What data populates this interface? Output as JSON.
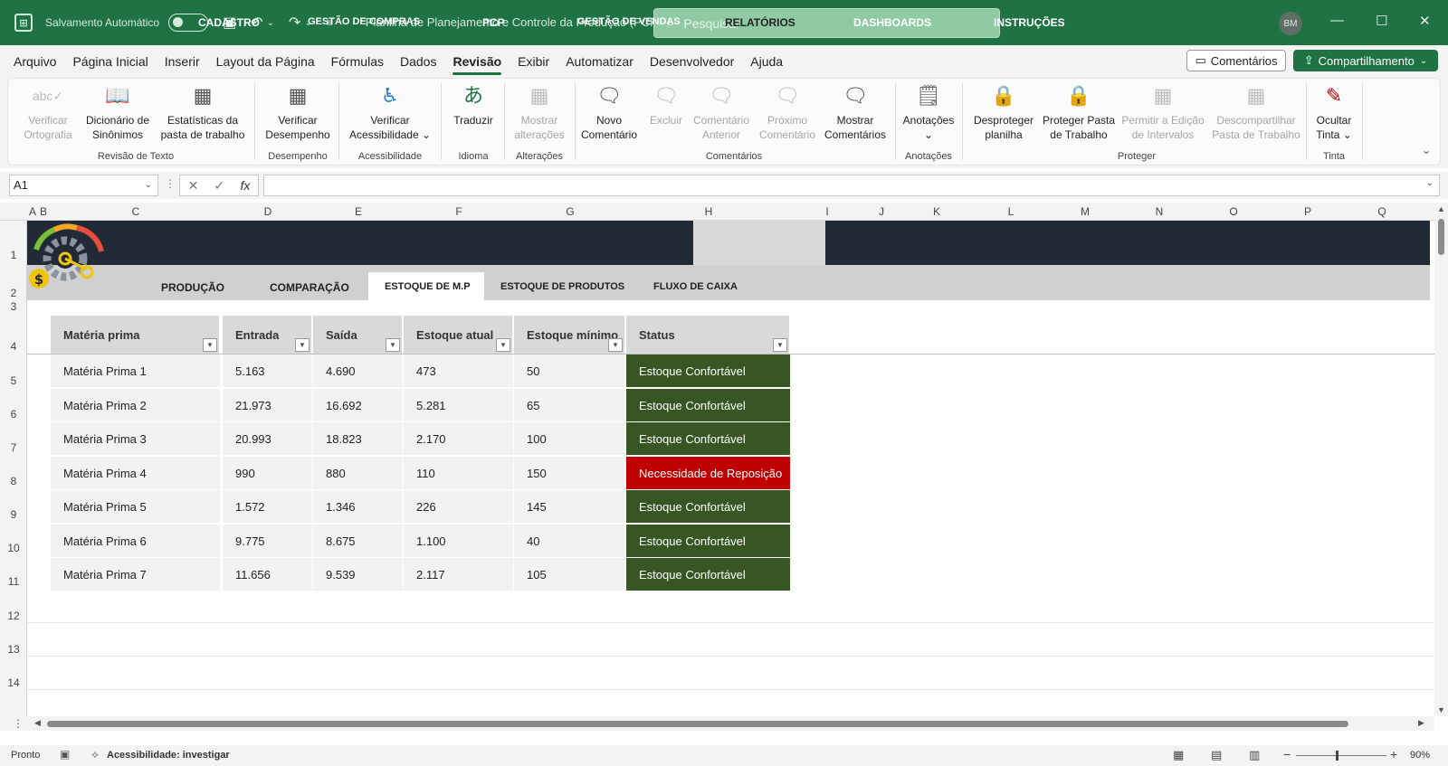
{
  "titlebar": {
    "autosave_label": "Salvamento Automático",
    "doc_title": "Planilha de Planejamento e Controle da Produção (PCP)",
    "search_placeholder": "Pesquisar",
    "avatar_initials": "BM"
  },
  "menu": {
    "items": [
      "Arquivo",
      "Página Inicial",
      "Inserir",
      "Layout da Página",
      "Fórmulas",
      "Dados",
      "Revisão",
      "Exibir",
      "Automatizar",
      "Desenvolvedor",
      "Ajuda"
    ],
    "active": "Revisão",
    "comments_label": "Comentários",
    "share_label": "Compartilhamento"
  },
  "ribbon": {
    "buttons": {
      "spell": "Verificar Ortografia",
      "thesaurus": "Dicionário de Sinônimos",
      "stats": "Estatísticas da pasta de trabalho",
      "perf": "Verificar Desempenho",
      "access": "Verificar Acessibilidade",
      "translate": "Traduzir",
      "changes": "Mostrar alterações",
      "new_comment": "Novo Comentário",
      "delete": "Excluir",
      "prev_comment": "Comentário Anterior",
      "next_comment": "Próximo Comentário",
      "show_comments": "Mostrar Comentários",
      "notes": "Anotações",
      "unprotect": "Desproteger planilha",
      "protect_wb": "Proteger Pasta de Trabalho",
      "allow_edit": "Permitir a Edição de Intervalos",
      "unshare": "Descompartilhar Pasta de Trabalho",
      "hide_ink": "Ocultar Tinta"
    },
    "groups": {
      "review_text": "Revisão de Texto",
      "performance": "Desempenho",
      "accessibility": "Acessibilidade",
      "language": "Idioma",
      "changes": "Alterações",
      "comments": "Comentários",
      "notes": "Anotações",
      "protect": "Proteger",
      "ink": "Tinta"
    }
  },
  "formula_bar": {
    "name_box": "A1",
    "fx": "fx"
  },
  "columns": [
    "A",
    "B",
    "C",
    "D",
    "E",
    "F",
    "G",
    "H",
    "I",
    "J",
    "K",
    "L",
    "M",
    "N",
    "O",
    "P",
    "Q"
  ],
  "rows": [
    "1",
    "2",
    "3",
    "4",
    "5",
    "6",
    "7",
    "8",
    "9",
    "10",
    "11",
    "12",
    "13",
    "14"
  ],
  "nav": {
    "items": [
      "CADASTRO",
      "GESTÃO DE COMPRAS",
      "PCP",
      "GESTÃO DE VENDAS",
      "RELATÓRIOS",
      "DASHBOARDS",
      "INSTRUÇÕES"
    ],
    "active": "RELATÓRIOS",
    "sub_items": [
      "PRODUÇÃO",
      "COMPARAÇÃO",
      "ESTOQUE DE M.P",
      "ESTOQUE DE PRODUTOS",
      "FLUXO DE CAIXA"
    ],
    "sub_active": "ESTOQUE DE M.P"
  },
  "table": {
    "headers": [
      "Matéria prima",
      "Entrada",
      "Saída",
      "Estoque atual",
      "Estoque mínimo",
      "Status"
    ],
    "rows": [
      [
        "Matéria Prima 1",
        "5.163",
        "4.690",
        "473",
        "50",
        "Estoque Confortável"
      ],
      [
        "Matéria Prima 2",
        "21.973",
        "16.692",
        "5.281",
        "65",
        "Estoque Confortável"
      ],
      [
        "Matéria Prima 3",
        "20.993",
        "18.823",
        "2.170",
        "100",
        "Estoque Confortável"
      ],
      [
        "Matéria Prima 4",
        "990",
        "880",
        "110",
        "150",
        "Necessidade de Reposição"
      ],
      [
        "Matéria Prima 5",
        "1.572",
        "1.346",
        "226",
        "145",
        "Estoque Confortável"
      ],
      [
        "Matéria Prima 6",
        "9.775",
        "8.675",
        "1.100",
        "40",
        "Estoque Confortável"
      ],
      [
        "Matéria Prima 7",
        "11.656",
        "9.539",
        "2.117",
        "105",
        "Estoque Confortável"
      ]
    ],
    "status_colors": {
      "Estoque Confortável": "#375623",
      "Necessidade de Reposição": "#c00000"
    }
  },
  "statusbar": {
    "ready": "Pronto",
    "accessibility": "Acessibilidade: investigar",
    "zoom": "90%"
  },
  "colors": {
    "brand": "#1f7244",
    "nav_bg": "#222a35"
  }
}
